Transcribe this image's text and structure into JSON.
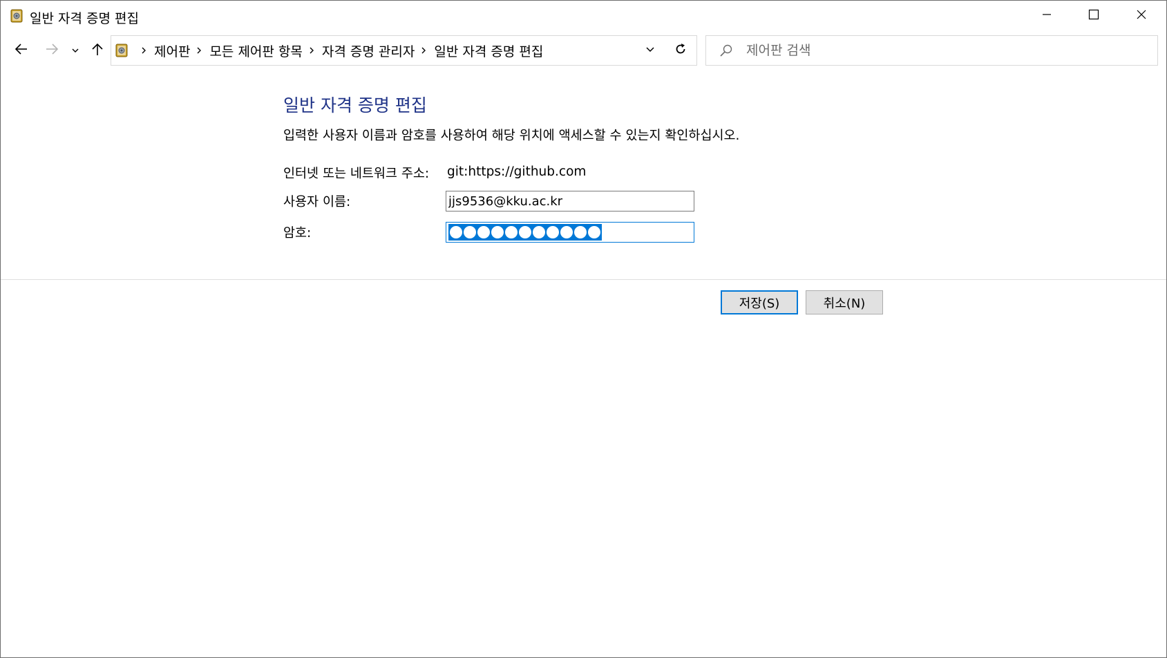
{
  "window": {
    "title": "일반 자격 증명 편집"
  },
  "breadcrumb": {
    "items": [
      "제어판",
      "모든 제어판 항목",
      "자격 증명 관리자",
      "일반 자격 증명 편집"
    ]
  },
  "search": {
    "placeholder": "제어판 검색",
    "value": ""
  },
  "form": {
    "heading": "일반 자격 증명 편집",
    "description": "입력한 사용자 이름과 암호를 사용하여 해당 위치에 액세스할 수 있는지 확인하십시오.",
    "address_label": "인터넷 또는 네트워크 주소:",
    "address_value": "git:https://github.com",
    "username_label": "사용자 이름:",
    "username_value": "jjs9536@kku.ac.kr",
    "password_label": "암호:",
    "password_mask_count": 11
  },
  "buttons": {
    "save_label": "저장(S)",
    "cancel_label": "취소(N)"
  },
  "colors": {
    "heading": "#1e3287",
    "accent": "#0078d7"
  },
  "icons": {
    "app": "credential-vault-icon",
    "back": "arrow-left-icon",
    "forward": "arrow-right-icon",
    "recent": "chevron-down-icon",
    "up": "arrow-up-icon",
    "refresh": "refresh-icon",
    "search": "search-icon",
    "minimize": "minimize-icon",
    "maximize": "maximize-icon",
    "close": "close-icon"
  }
}
